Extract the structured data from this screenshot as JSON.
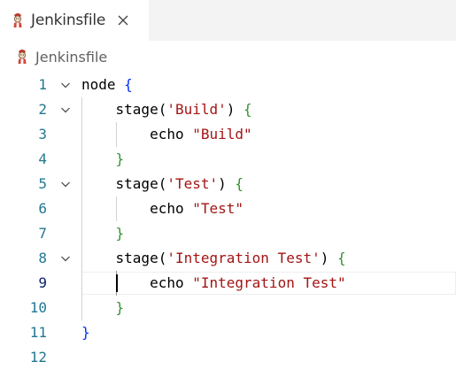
{
  "tab": {
    "label": "Jenkinsfile",
    "icon": "jenkins-icon",
    "close_icon": "close-icon"
  },
  "breadcrumb": {
    "label": "Jenkinsfile",
    "icon": "jenkins-icon"
  },
  "editor": {
    "current_line": 9,
    "lines": [
      {
        "number": "1",
        "foldable": true,
        "tokens": [
          {
            "text": "node ",
            "type": "plain"
          },
          {
            "text": "{",
            "type": "brace1"
          }
        ]
      },
      {
        "number": "2",
        "foldable": true,
        "tokens": [
          {
            "text": "    stage(",
            "type": "plain"
          },
          {
            "text": "'Build'",
            "type": "string"
          },
          {
            "text": ") ",
            "type": "plain"
          },
          {
            "text": "{",
            "type": "brace2"
          }
        ]
      },
      {
        "number": "3",
        "foldable": false,
        "tokens": [
          {
            "text": "        echo ",
            "type": "plain"
          },
          {
            "text": "\"Build\"",
            "type": "string"
          }
        ]
      },
      {
        "number": "4",
        "foldable": false,
        "tokens": [
          {
            "text": "    ",
            "type": "plain"
          },
          {
            "text": "}",
            "type": "brace2"
          }
        ]
      },
      {
        "number": "5",
        "foldable": true,
        "tokens": [
          {
            "text": "    stage(",
            "type": "plain"
          },
          {
            "text": "'Test'",
            "type": "string"
          },
          {
            "text": ") ",
            "type": "plain"
          },
          {
            "text": "{",
            "type": "brace2"
          }
        ]
      },
      {
        "number": "6",
        "foldable": false,
        "tokens": [
          {
            "text": "        echo ",
            "type": "plain"
          },
          {
            "text": "\"Test\"",
            "type": "string"
          }
        ]
      },
      {
        "number": "7",
        "foldable": false,
        "tokens": [
          {
            "text": "    ",
            "type": "plain"
          },
          {
            "text": "}",
            "type": "brace2"
          }
        ]
      },
      {
        "number": "8",
        "foldable": true,
        "tokens": [
          {
            "text": "    stage(",
            "type": "plain"
          },
          {
            "text": "'Integration Test'",
            "type": "string"
          },
          {
            "text": ") ",
            "type": "plain"
          },
          {
            "text": "{",
            "type": "brace2"
          }
        ]
      },
      {
        "number": "9",
        "foldable": false,
        "tokens": [
          {
            "text": "        echo ",
            "type": "plain"
          },
          {
            "text": "\"Integration Test\"",
            "type": "string"
          }
        ]
      },
      {
        "number": "10",
        "foldable": false,
        "tokens": [
          {
            "text": "    ",
            "type": "plain"
          },
          {
            "text": "}",
            "type": "brace2"
          }
        ]
      },
      {
        "number": "11",
        "foldable": false,
        "tokens": [
          {
            "text": "}",
            "type": "brace1"
          }
        ]
      },
      {
        "number": "12",
        "foldable": false,
        "tokens": []
      }
    ]
  },
  "colors": {
    "plain": "#000000",
    "string": "#a31515",
    "brace1": "#0431fa",
    "brace2": "#319331",
    "line_number": "#237893",
    "current_line_number": "#0b216f"
  }
}
